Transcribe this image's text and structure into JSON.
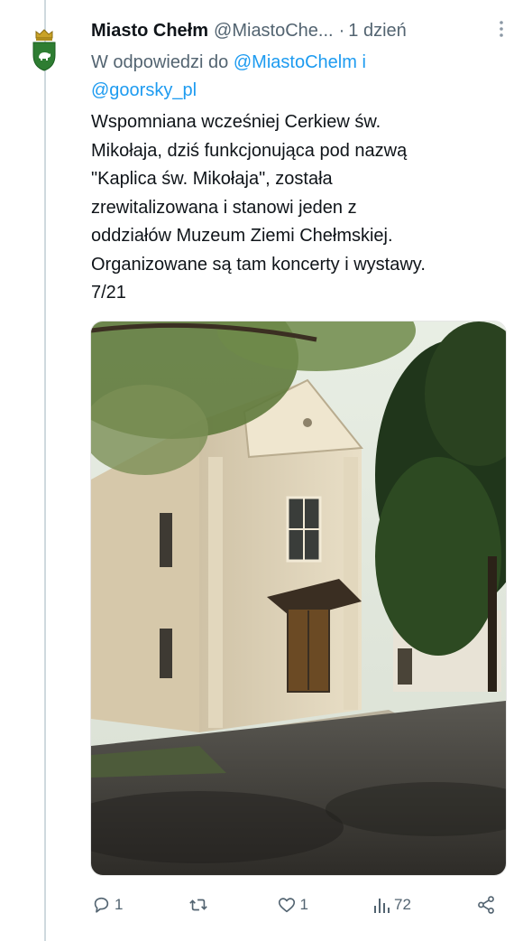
{
  "tweet": {
    "author_name": "Miasto Chełm",
    "author_handle": "@MiastoChe...",
    "separator": "·",
    "time": "1 dzień",
    "reply_prefix": "W odpowiedzi do",
    "reply_mention_1": "@MiastoChelm",
    "reply_and": "i",
    "reply_mention_2": "@goorsky_pl",
    "text_lines": [
      "Wspomniana wcześniej Cerkiew św.",
      "Mikołaja, dziś funkcjonująca pod nazwą",
      "\"Kaplica św. Mikołaja\", została",
      "zrewitalizowana i stanowi jeden z",
      "oddziałów Muzeum Ziemi Chełmskiej.",
      "Organizowane są tam koncerty i wystawy.",
      "7/21"
    ]
  },
  "actions": {
    "replies": "1",
    "retweets": "",
    "likes": "1",
    "views": "72"
  },
  "icons": {
    "avatar": "chelm-coat-of-arms-icon",
    "more": "more-vertical-icon",
    "reply": "reply-bubble-icon",
    "retweet": "retweet-icon",
    "like": "heart-icon",
    "views": "views-bars-icon",
    "share": "share-icon"
  },
  "colors": {
    "link": "#1d9bf0",
    "secondary_text": "#536471",
    "thread_line": "#cfd9de",
    "avatar_green": "#2e7d32"
  }
}
